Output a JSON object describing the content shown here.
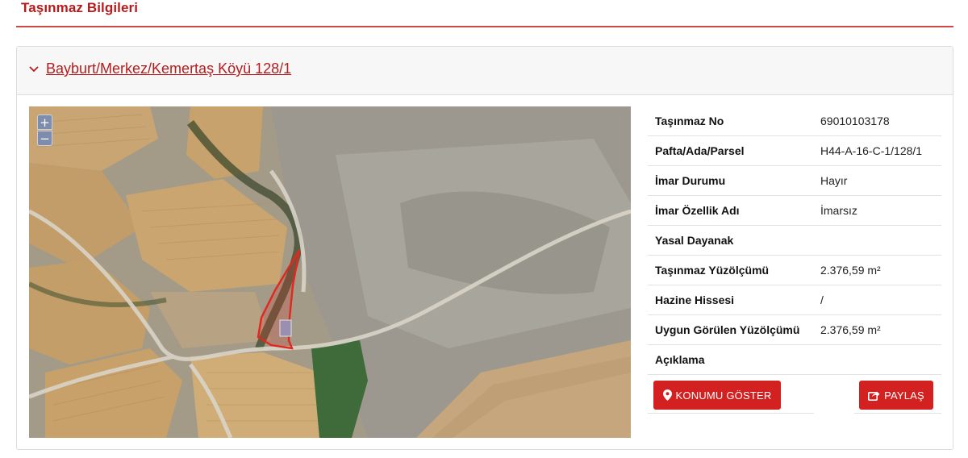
{
  "page": {
    "title": "Taşınmaz Bilgileri"
  },
  "property": {
    "location_link": "Bayburt/Merkez/Kemertaş Köyü 128/1",
    "fields": [
      {
        "label": "Taşınmaz No",
        "value": "69010103178"
      },
      {
        "label": "Pafta/Ada/Parsel",
        "value": "H44-A-16-C-1/128/1"
      },
      {
        "label": "İmar Durumu",
        "value": "Hayır"
      },
      {
        "label": "İmar Özellik Adı",
        "value": "İmarsız"
      },
      {
        "label": "Yasal Dayanak",
        "value": ""
      },
      {
        "label": "Taşınmaz Yüzölçümü",
        "value": "2.376,59 m²"
      },
      {
        "label": "Hazine Hissesi",
        "value": "/"
      },
      {
        "label": "Uygun Görülen Yüzölçümü",
        "value": "2.376,59 m²"
      },
      {
        "label": "Açıklama",
        "value": ""
      }
    ]
  },
  "map": {
    "zoom_in_label": "+",
    "zoom_out_label": "−",
    "parcel_outline_color": "#e0281e"
  },
  "actions": {
    "show_location_label": "KONUMU GÖSTER",
    "share_label": "PAYLAŞ"
  },
  "colors": {
    "accent": "#b71c1c",
    "button": "#d32020"
  },
  "icons": {
    "collapse": "chevron-down-icon",
    "location": "map-marker-icon",
    "share": "share-icon"
  }
}
